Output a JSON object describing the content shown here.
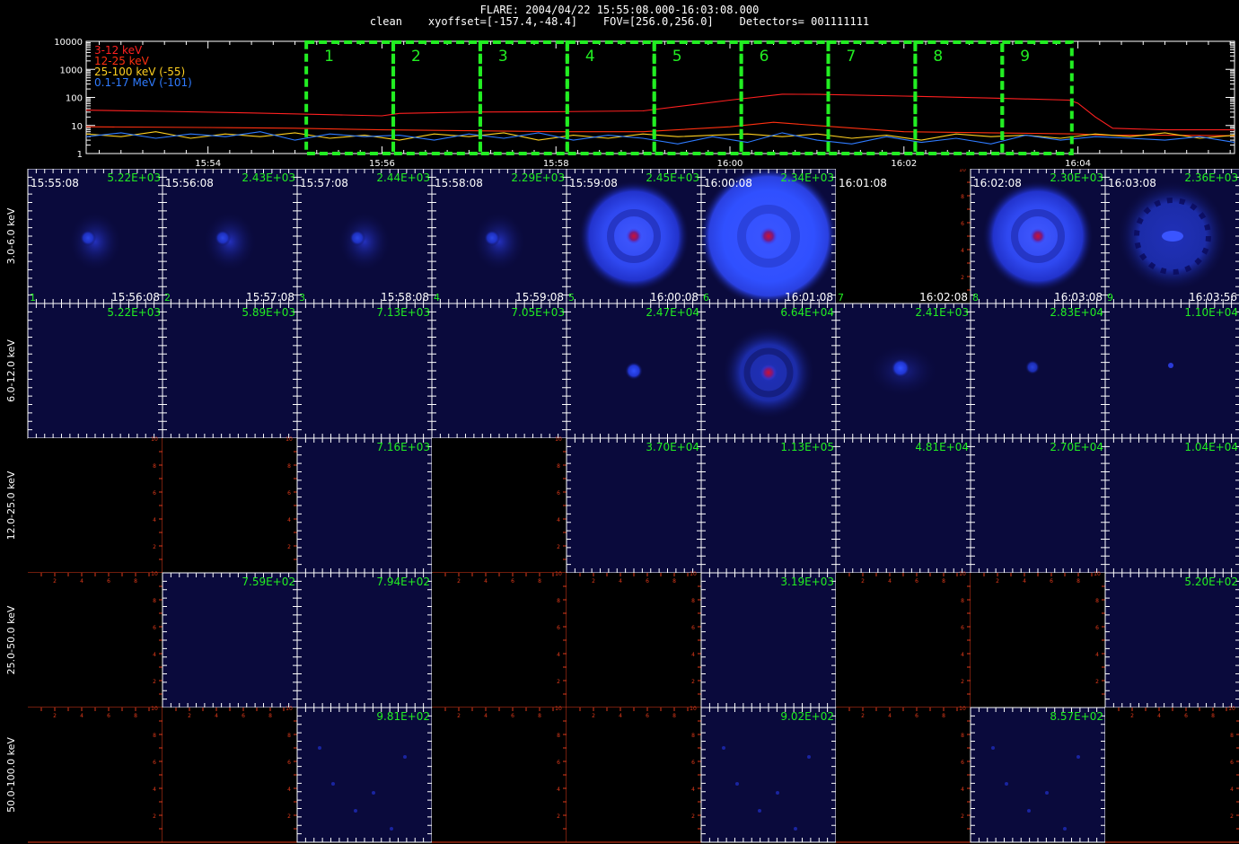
{
  "header": {
    "title": "FLARE: 2004/04/22 15:55:08.000-16:03:08.000",
    "subtitle": "clean    xyoffset=[-157.4,-48.4]    FOV=[256.0,256.0]    Detectors= 001111111"
  },
  "colors": {
    "background": "#000000",
    "panel_bg": "#0a0a3c",
    "interval_box": "#22ee22",
    "value_text": "#22ee22",
    "red_axis": "#e03a1a",
    "series_3_12": "#ff2020",
    "series_12_25": "#ff3010",
    "series_25_100": "#ffd020",
    "series_01_17": "#2f7bff"
  },
  "chart_data": [
    {
      "type": "line",
      "title": "",
      "xlabel": "",
      "ylabel": "",
      "yscale": "log",
      "ylim": [
        1,
        10000
      ],
      "y_ticks": [
        "1",
        "10",
        "100",
        "1000",
        "10000"
      ],
      "x_ticks": [
        "15:54",
        "15:56",
        "15:58",
        "16:00",
        "16:02",
        "16:04"
      ],
      "x_tick_minutes": [
        0,
        2,
        4,
        6,
        8,
        10
      ],
      "xlim_minutes": [
        -1.4,
        11.8
      ],
      "legend_position": "top-left",
      "legend": [
        "3-12 keV",
        "12-25 keV",
        "25-100 keV (-55)",
        "0.1-17 MeV (-101)"
      ],
      "series": [
        {
          "name": "3-12 keV",
          "color": "#ff2020",
          "x": [
            -1.4,
            -0.5,
            0.5,
            1.5,
            2.0,
            2.2,
            3.0,
            4.0,
            5.0,
            6.0,
            6.6,
            7.0,
            8.0,
            9.0,
            9.9,
            10.0,
            10.2,
            10.4,
            11.0,
            11.8
          ],
          "y": [
            35,
            32,
            28,
            24,
            22,
            27,
            30,
            31,
            33,
            80,
            130,
            128,
            112,
            95,
            80,
            62,
            20,
            8,
            7,
            7
          ]
        },
        {
          "name": "12-25 keV",
          "color": "#ff3010",
          "x": [
            -1.4,
            0,
            1,
            2,
            3,
            4,
            5,
            6,
            6.5,
            7,
            8,
            9,
            10,
            10.3,
            11,
            11.8
          ],
          "y": [
            9,
            8.5,
            8,
            7,
            6.5,
            6,
            6,
            9,
            13,
            10,
            6,
            5.5,
            5,
            4.5,
            4.5,
            4.3
          ]
        },
        {
          "name": "25-100 keV (-55)",
          "color": "#ffd020",
          "x": [
            -1.4,
            -1.0,
            -0.6,
            -0.2,
            0.2,
            0.6,
            1.0,
            1.4,
            1.8,
            2.2,
            2.6,
            3.0,
            3.4,
            3.8,
            4.2,
            4.6,
            5.0,
            5.4,
            5.8,
            6.2,
            6.6,
            7.0,
            7.4,
            7.8,
            8.2,
            8.6,
            9.0,
            9.4,
            9.8,
            10.2,
            10.6,
            11.0,
            11.4,
            11.8
          ],
          "y": [
            5,
            4,
            6,
            3.5,
            5,
            4,
            5.5,
            3.5,
            4.5,
            3,
            5,
            4,
            5.5,
            3,
            4.5,
            3.5,
            5,
            4,
            4.5,
            5,
            4,
            5,
            3.5,
            4.5,
            3,
            5,
            4,
            4.5,
            3.5,
            5,
            4,
            5.5,
            3.5,
            4.5
          ]
        },
        {
          "name": "0.1-17 MeV (-101)",
          "color": "#2f7bff",
          "x": [
            -1.4,
            -1.0,
            -0.6,
            -0.2,
            0.2,
            0.6,
            1.0,
            1.4,
            1.8,
            2.2,
            2.6,
            3.0,
            3.4,
            3.8,
            4.2,
            4.6,
            5.0,
            5.4,
            5.8,
            6.2,
            6.6,
            7.0,
            7.4,
            7.8,
            8.2,
            8.6,
            9.0,
            9.4,
            9.8,
            10.2,
            10.6,
            11.0,
            11.4,
            11.8
          ],
          "y": [
            4,
            5.5,
            3.5,
            5,
            4,
            6,
            3,
            5,
            4,
            4.5,
            3,
            5,
            3.5,
            5.5,
            3,
            4.5,
            3.5,
            2.2,
            4,
            2.5,
            5.5,
            3,
            2.2,
            4,
            2.5,
            3.5,
            2.2,
            4.5,
            3,
            4,
            3.5,
            3,
            4,
            2.5
          ]
        }
      ],
      "intervals": [
        {
          "label": "1",
          "start_minute": 1.13,
          "end_minute": 2.13
        },
        {
          "label": "2",
          "start_minute": 2.13,
          "end_minute": 3.13
        },
        {
          "label": "3",
          "start_minute": 3.13,
          "end_minute": 4.13
        },
        {
          "label": "4",
          "start_minute": 4.13,
          "end_minute": 5.13
        },
        {
          "label": "5",
          "start_minute": 5.13,
          "end_minute": 6.13
        },
        {
          "label": "6",
          "start_minute": 6.13,
          "end_minute": 7.13
        },
        {
          "label": "7",
          "start_minute": 7.13,
          "end_minute": 8.13
        },
        {
          "label": "8",
          "start_minute": 8.13,
          "end_minute": 9.13
        },
        {
          "label": "9",
          "start_minute": 9.13,
          "end_minute": 9.93
        }
      ]
    },
    {
      "type": "heatmap",
      "title": "",
      "energy_bands": [
        "3.0-6.0 keV",
        "6.0-12.0 keV",
        "12.0-25.0 keV",
        "25.0-50.0 keV",
        "50.0-100.0 keV"
      ],
      "time_bins": [
        {
          "index": "1",
          "start": "15:55:08",
          "end": "15:56:08"
        },
        {
          "index": "2",
          "start": "15:56:08",
          "end": "15:57:08"
        },
        {
          "index": "3",
          "start": "15:57:08",
          "end": "15:58:08"
        },
        {
          "index": "4",
          "start": "15:58:08",
          "end": "15:59:08"
        },
        {
          "index": "5",
          "start": "15:59:08",
          "end": "16:00:08"
        },
        {
          "index": "6",
          "start": "16:00:08",
          "end": "16:01:08"
        },
        {
          "index": "7",
          "start": "16:01:08",
          "end": "16:02:08"
        },
        {
          "index": "8",
          "start": "16:02:08",
          "end": "16:03:08"
        },
        {
          "index": "9",
          "start": "16:03:08",
          "end": "16:03:56"
        }
      ],
      "axis_ticks": [
        "2",
        "4",
        "6",
        "8",
        "10"
      ],
      "cells": [
        [
          {
            "value": "5.22E+03",
            "image": "faint"
          },
          {
            "value": "2.43E+03",
            "image": "faint"
          },
          {
            "value": "2.44E+03",
            "image": "faint"
          },
          {
            "value": "2.29E+03",
            "image": "faint"
          },
          {
            "value": "2.45E+03",
            "image": "disk"
          },
          {
            "value": "2.34E+03",
            "image": "bigdisk"
          },
          {
            "value": "",
            "image": "empty"
          },
          {
            "value": "2.30E+03",
            "image": "disk"
          },
          {
            "value": "2.36E+03",
            "image": "ring"
          }
        ],
        [
          {
            "value": "5.22E+03",
            "image": "blank"
          },
          {
            "value": "5.89E+03",
            "image": "blank"
          },
          {
            "value": "7.13E+03",
            "image": "blank"
          },
          {
            "value": "7.05E+03",
            "image": "blank"
          },
          {
            "value": "2.47E+04",
            "image": "spot"
          },
          {
            "value": "6.64E+04",
            "image": "halo"
          },
          {
            "value": "2.41E+03",
            "image": "spot2"
          },
          {
            "value": "2.83E+04",
            "image": "spot3"
          },
          {
            "value": "1.10E+04",
            "image": "dot"
          }
        ],
        [
          {
            "value": "",
            "image": "empty"
          },
          {
            "value": "",
            "image": "empty"
          },
          {
            "value": "7.16E+03",
            "image": "blank"
          },
          {
            "value": "",
            "image": "empty"
          },
          {
            "value": "3.70E+04",
            "image": "blank"
          },
          {
            "value": "1.13E+05",
            "image": "blank"
          },
          {
            "value": "4.81E+04",
            "image": "blank"
          },
          {
            "value": "2.70E+04",
            "image": "blank"
          },
          {
            "value": "1.04E+04",
            "image": "blank"
          }
        ],
        [
          {
            "value": "",
            "image": "empty"
          },
          {
            "value": "7.59E+02",
            "image": "blank"
          },
          {
            "value": "7.94E+02",
            "image": "blank"
          },
          {
            "value": "",
            "image": "empty"
          },
          {
            "value": "",
            "image": "empty"
          },
          {
            "value": "3.19E+03",
            "image": "blank"
          },
          {
            "value": "",
            "image": "empty"
          },
          {
            "value": "",
            "image": "empty"
          },
          {
            "value": "5.20E+02",
            "image": "blank"
          }
        ],
        [
          {
            "value": "",
            "image": "empty"
          },
          {
            "value": "",
            "image": "empty"
          },
          {
            "value": "9.81E+02",
            "image": "speckle"
          },
          {
            "value": "",
            "image": "empty"
          },
          {
            "value": "",
            "image": "empty"
          },
          {
            "value": "9.02E+02",
            "image": "speckle"
          },
          {
            "value": "",
            "image": "empty"
          },
          {
            "value": "8.57E+02",
            "image": "speckle"
          },
          {
            "value": "",
            "image": "empty"
          }
        ]
      ]
    }
  ]
}
